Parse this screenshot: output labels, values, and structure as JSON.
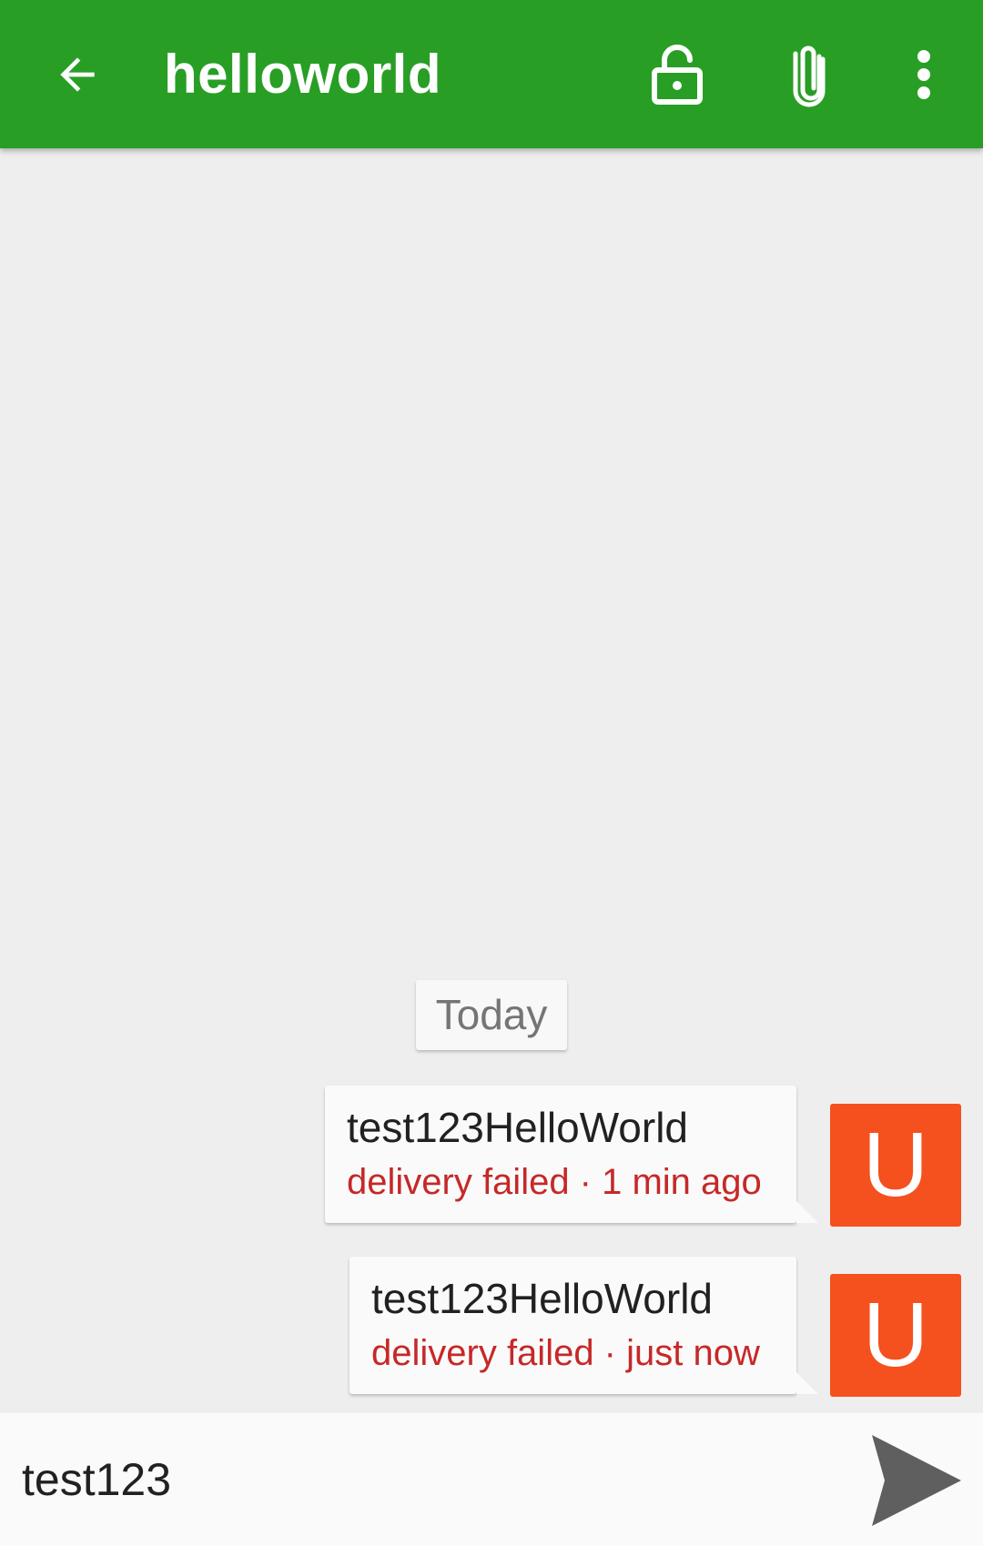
{
  "colors": {
    "toolbar": "#289e25",
    "avatar": "#f4511e",
    "status_error": "#c62828",
    "background": "#eeeeee"
  },
  "toolbar": {
    "back_icon": "arrow-left-icon",
    "title": "helloworld",
    "encryption_icon": "lock-open-icon",
    "attach_icon": "paperclip-icon",
    "menu_icon": "more-vertical-icon"
  },
  "conversation": {
    "date_separator": "Today",
    "messages": [
      {
        "text": "test123HelloWorld",
        "status": "delivery failed · 1 min ago",
        "avatar_letter": "U"
      },
      {
        "text": "test123HelloWorld",
        "status": "delivery failed · just now",
        "avatar_letter": "U"
      }
    ]
  },
  "composer": {
    "value": "test123",
    "send_icon": "send-icon"
  }
}
